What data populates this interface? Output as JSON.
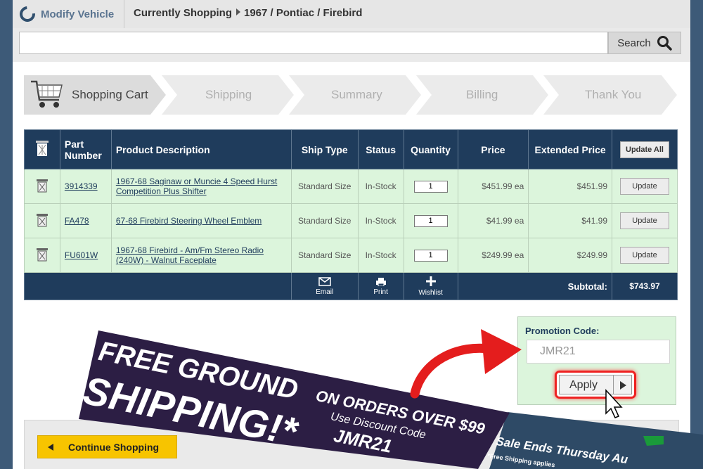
{
  "header": {
    "modify_label": "Modify Vehicle",
    "currently_shopping": "Currently Shopping",
    "vehicle": "1967 / Pontiac / Firebird"
  },
  "search": {
    "button_label": "Search",
    "placeholder": ""
  },
  "steps": [
    "Shopping Cart",
    "Shipping",
    "Summary",
    "Billing",
    "Thank You"
  ],
  "cart": {
    "headers": {
      "part_number": "Part Number",
      "description": "Product Description",
      "ship_type": "Ship Type",
      "status": "Status",
      "quantity": "Quantity",
      "price": "Price",
      "extended_price": "Extended Price",
      "update_all": "Update All"
    },
    "rows": [
      {
        "part": "3914339",
        "desc": "1967-68 Saginaw or Muncie 4 Speed Hurst Competition Plus Shifter",
        "ship": "Standard Size",
        "status": "In-Stock",
        "qty": "1",
        "price": "$451.99 ea",
        "ext": "$451.99",
        "update": "Update"
      },
      {
        "part": "FA478",
        "desc": "67-68 Firebird Steering Wheel Emblem",
        "ship": "Standard Size",
        "status": "In-Stock",
        "qty": "1",
        "price": "$41.99 ea",
        "ext": "$41.99",
        "update": "Update"
      },
      {
        "part": "FU601W",
        "desc": "1967-68 Firebird - Am/Fm Stereo Radio (240W) - Walnut Faceplate",
        "ship": "Standard Size",
        "status": "In-Stock",
        "qty": "1",
        "price": "$249.99 ea",
        "ext": "$249.99",
        "update": "Update"
      }
    ],
    "footer": {
      "email": "Email",
      "print": "Print",
      "wishlist": "Wishlist",
      "subtotal_label": "Subtotal:",
      "subtotal": "$743.97"
    }
  },
  "promo": {
    "label": "Promotion Code:",
    "code": "JMR21",
    "apply": "Apply"
  },
  "continue_label": "Continue Shopping",
  "banner": {
    "line1": "FREE GROUND",
    "line2": "SHIPPING!*",
    "on_orders": "ON ORDERS OVER $99",
    "use_code": "Use Discount Code",
    "code": "JMR21",
    "sale": "Sale Ends Thursday Au",
    "fine": "*Free Shipping applies"
  },
  "colors": {
    "navy": "#1f3c5c",
    "row_green": "#dcf5dc",
    "yellow": "#f7c400",
    "banner_purple": "#2c1e44",
    "arrow_red": "#e41d1d"
  }
}
